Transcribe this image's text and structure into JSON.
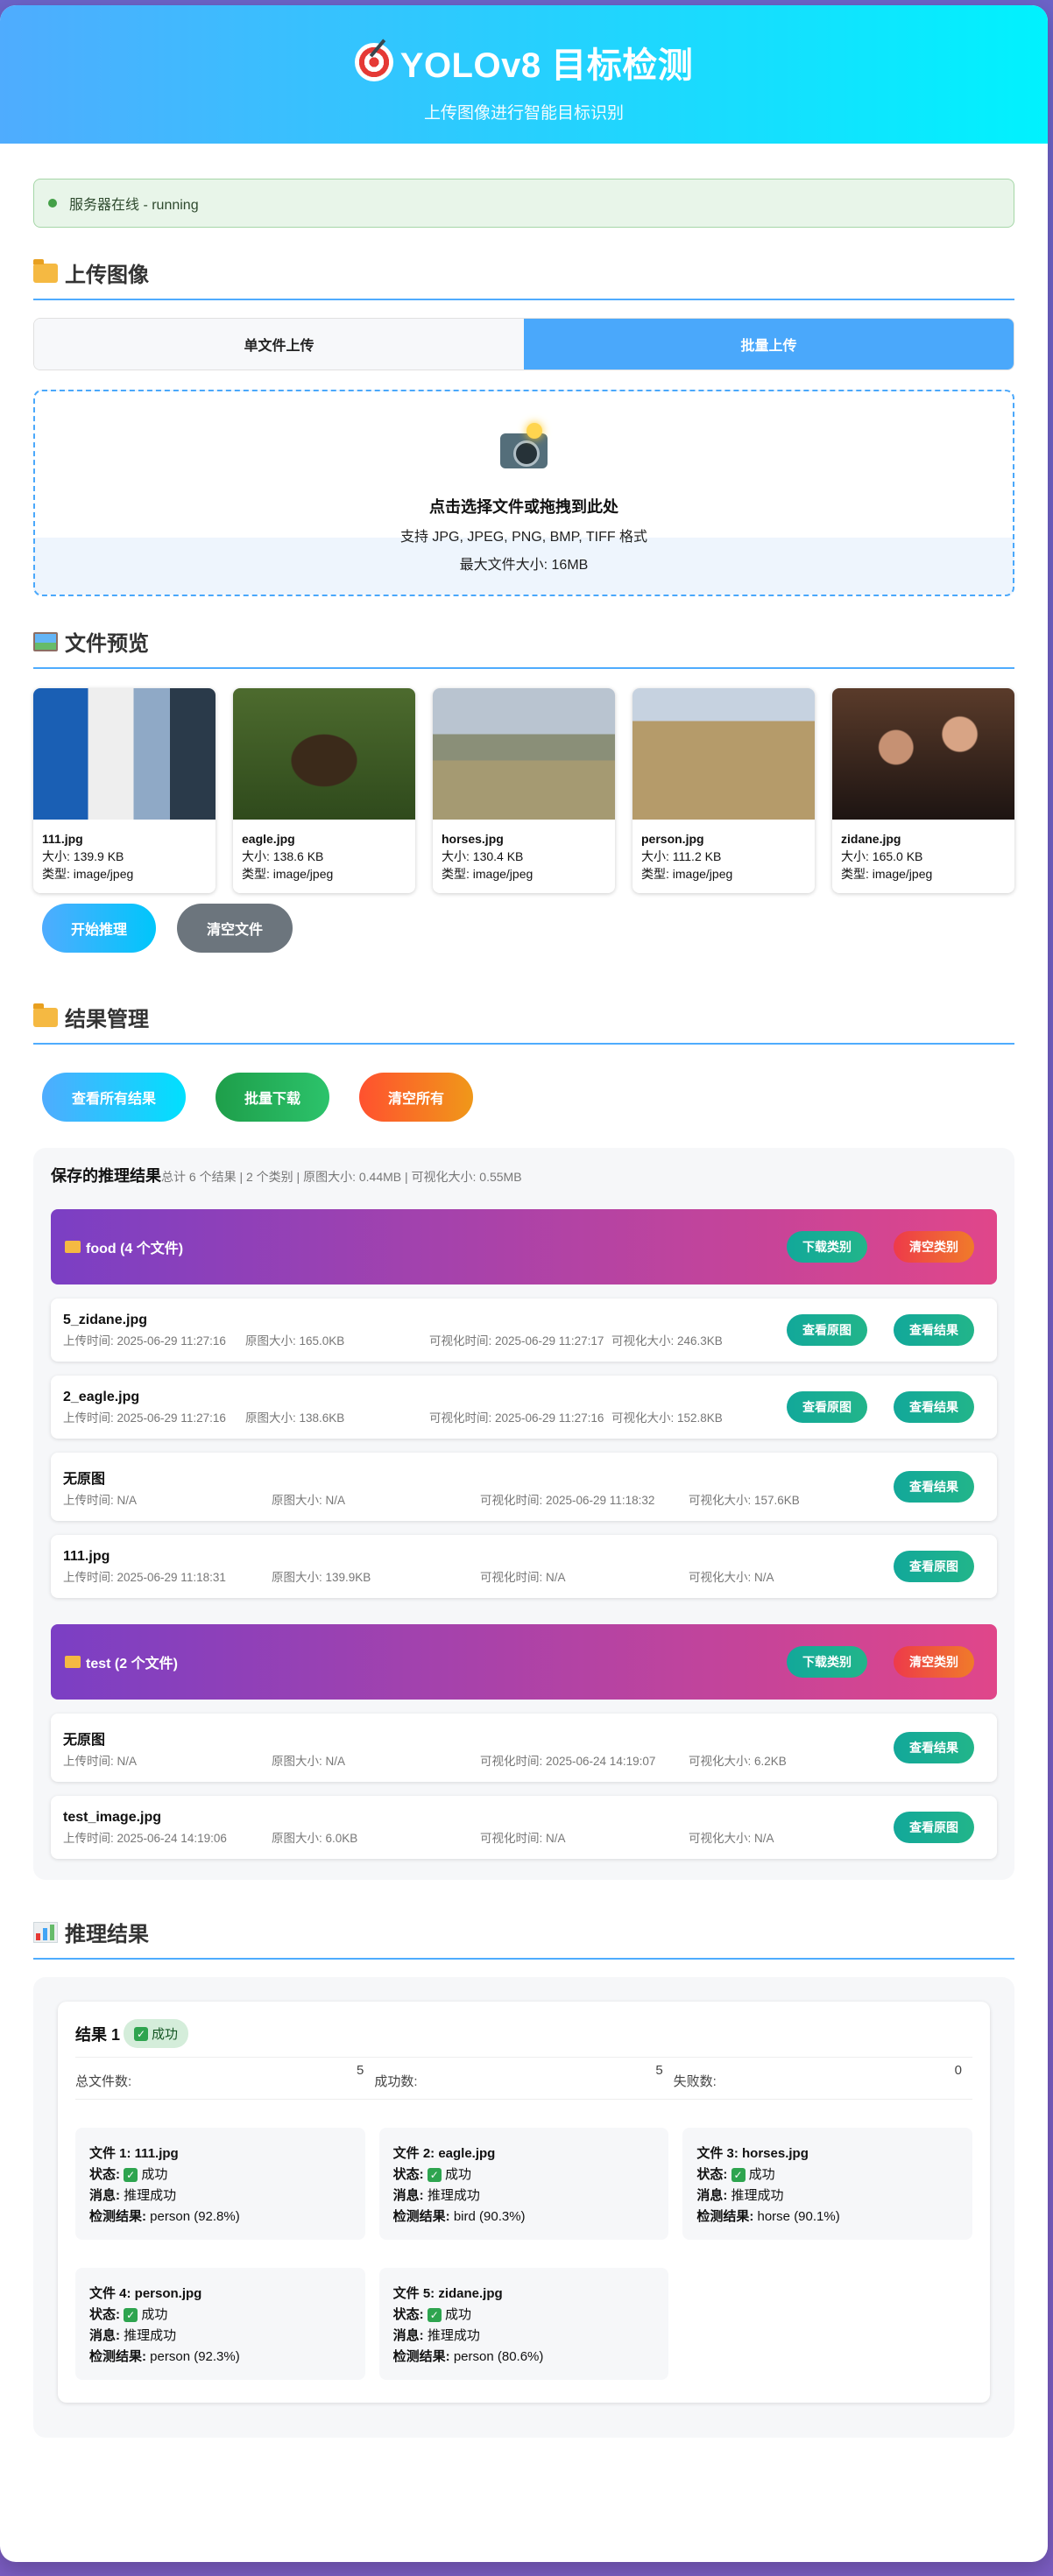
{
  "header": {
    "title": "YOLOv8 目标检测",
    "subtitle": "上传图像进行智能目标识别"
  },
  "status": {
    "text": "服务器在线 - running",
    "color": "#43a047"
  },
  "upload": {
    "title": "上传图像",
    "tabs": [
      "单文件上传",
      "批量上传"
    ],
    "active_tab": "批量上传",
    "drop": {
      "title": "点击选择文件或拖拽到此处",
      "formats": "支持 JPG, JPEG, PNG, BMP, TIFF 格式",
      "max": "最大文件大小: 16MB"
    }
  },
  "preview": {
    "title": "文件预览",
    "files": [
      {
        "name": "111.jpg",
        "size": "大小: 139.9 KB",
        "type": "类型: image/jpeg"
      },
      {
        "name": "eagle.jpg",
        "size": "大小: 138.6 KB",
        "type": "类型: image/jpeg"
      },
      {
        "name": "horses.jpg",
        "size": "大小: 130.4 KB",
        "type": "类型: image/jpeg"
      },
      {
        "name": "person.jpg",
        "size": "大小: 111.2 KB",
        "type": "类型: image/jpeg"
      },
      {
        "name": "zidane.jpg",
        "size": "大小: 165.0 KB",
        "type": "类型: image/jpeg"
      }
    ],
    "start_btn": "开始推理",
    "clear_btn": "清空文件"
  },
  "manage": {
    "title": "结果管理",
    "view_all": "查看所有结果",
    "batch_download": "批量下载",
    "clear_all": "清空所有",
    "saved_title": "保存的推理结果",
    "summary": "总计 6 个结果 | 2 个类别 | 原图大小: 0.44MB | 可视化大小: 0.55MB",
    "download_cat": "下载类别",
    "clear_cat": "清空类别",
    "view_orig": "查看原图",
    "view_result": "查看结果",
    "categories": [
      {
        "name": "food (4 个文件)",
        "files": [
          {
            "name": "5_zidane.jpg",
            "upload": "上传时间: 2025-06-29 11:27:16",
            "orig": "原图大小: 165.0KB",
            "vis": "可视化时间: 2025-06-29 11:27:17",
            "vsize": "可视化大小: 246.3KB"
          },
          {
            "name": "2_eagle.jpg",
            "upload": "上传时间: 2025-06-29 11:27:16",
            "orig": "原图大小: 138.6KB",
            "vis": "可视化时间: 2025-06-29 11:27:16",
            "vsize": "可视化大小: 152.8KB"
          },
          {
            "name": "无原图",
            "upload": "上传时间: N/A",
            "orig": "原图大小: N/A",
            "vis": "可视化时间: 2025-06-29 11:18:32",
            "vsize": "可视化大小: 157.6KB"
          },
          {
            "name": "111.jpg",
            "upload": "上传时间: 2025-06-29 11:18:31",
            "orig": "原图大小: 139.9KB",
            "vis": "可视化时间: N/A",
            "vsize": "可视化大小: N/A"
          }
        ]
      },
      {
        "name": "test (2 个文件)",
        "files": [
          {
            "name": "无原图",
            "upload": "上传时间: N/A",
            "orig": "原图大小: N/A",
            "vis": "可视化时间: 2025-06-24 14:19:07",
            "vsize": "可视化大小: 6.2KB"
          },
          {
            "name": "test_image.jpg",
            "upload": "上传时间: 2025-06-24 14:19:06",
            "orig": "原图大小: 6.0KB",
            "vis": "可视化时间: N/A",
            "vsize": "可视化大小: N/A"
          }
        ]
      }
    ]
  },
  "results": {
    "title": "推理结果",
    "card_title": "结果 1",
    "badge": "成功",
    "stats": [
      {
        "label": "总文件数:",
        "value": "5"
      },
      {
        "label": "成功数:",
        "value": "5"
      },
      {
        "label": "失败数:",
        "value": "0"
      }
    ],
    "labels": {
      "status": "状态:",
      "message": "消息:",
      "detect": "检测结果:"
    },
    "files": [
      {
        "title": "文件 1: 111.jpg",
        "status": "成功",
        "message": "推理成功",
        "detect": "person (92.8%)"
      },
      {
        "title": "文件 2: eagle.jpg",
        "status": "成功",
        "message": "推理成功",
        "detect": "bird (90.3%)"
      },
      {
        "title": "文件 3: horses.jpg",
        "status": "成功",
        "message": "推理成功",
        "detect": "horse (90.1%)"
      },
      {
        "title": "文件 4: person.jpg",
        "status": "成功",
        "message": "推理成功",
        "detect": "person (92.3%)"
      },
      {
        "title": "文件 5: zidane.jpg",
        "status": "成功",
        "message": "推理成功",
        "detect": "person (80.6%)"
      }
    ]
  }
}
